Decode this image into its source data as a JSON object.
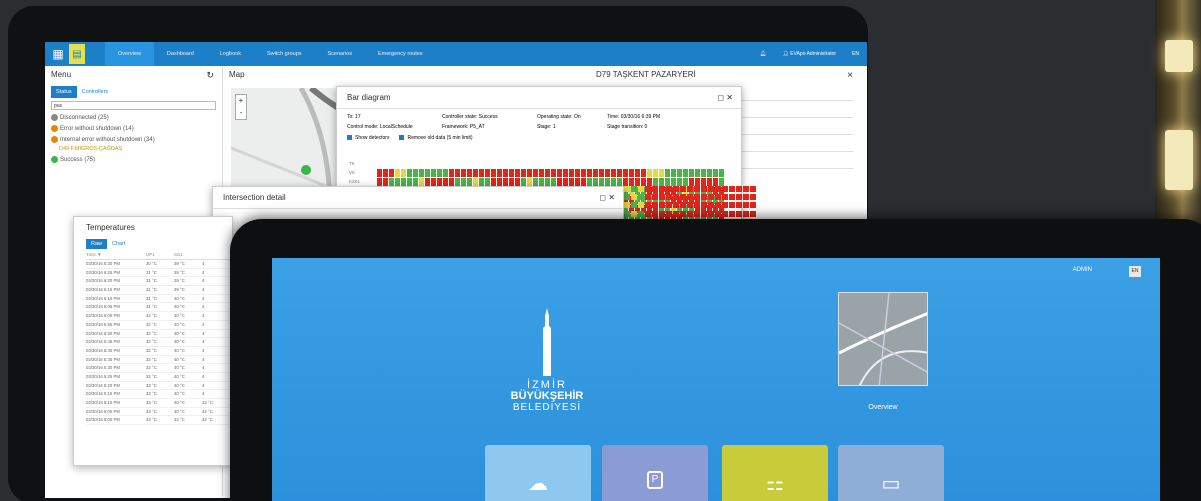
{
  "back_app": {
    "nav": {
      "tabs": [
        "Overview",
        "Dashboard",
        "Logbook",
        "Switch groups",
        "Scenarios",
        "Emergency routes"
      ],
      "active_tab": 0,
      "user": "EVApo Administrator",
      "lang": "EN"
    },
    "menu": {
      "title": "Menu",
      "tabs": [
        "Status",
        "Controllers"
      ],
      "search_value": "pus",
      "items": [
        {
          "label": "Disconnected (25)",
          "color": "#888888"
        },
        {
          "label": "Error without shutdown (14)",
          "color": "#e8830c"
        },
        {
          "label": "Internal error without shutdown (34)",
          "color": "#e8830c"
        },
        {
          "label": "Success (75)",
          "color": "#3ab54a"
        }
      ],
      "sub_item": "D49 F.MIGROS-ÇAĞDAŞ"
    },
    "map": {
      "title": "Map",
      "zoom_in": "+",
      "zoom_out": "-"
    },
    "right_panel": {
      "title": "D79 TAŞKENT PAZARYERİ",
      "close": "×"
    },
    "bar_diagram": {
      "title": "Bar diagram",
      "fields": [
        "To: 17",
        "Controller state: Success",
        "Operating state: On",
        "Time: 03/30/16 6:39 PM",
        "Control mode: LocalSchedule",
        "Framework: P5_AT",
        "Stage: 1",
        "Stage transition: 0"
      ],
      "checkboxes": [
        "Show detectors",
        "Remove old data (5 min limit)"
      ],
      "rows": [
        "TK",
        "VK",
        "K2K1",
        "",
        "",
        "",
        ""
      ]
    },
    "intersection": {
      "title": "Intersection detail"
    },
    "temperatures": {
      "title": "Temperatures",
      "tabs": [
        "Raw",
        "Chart"
      ],
      "headers": [
        "Time ▼",
        "UP1",
        "SS1",
        ""
      ],
      "rows": [
        [
          "03/30/16 6:30 PM",
          "30 °C",
          "39 °C",
          "4"
        ],
        [
          "03/30/16 6:25 PM",
          "31 °C",
          "39 °C",
          "4"
        ],
        [
          "03/30/16 6:20 PM",
          "31 °C",
          "39 °C",
          "4"
        ],
        [
          "03/30/16 6:15 PM",
          "31 °C",
          "39 °C",
          "4"
        ],
        [
          "03/30/16 6:10 PM",
          "31 °C",
          "40 °C",
          "4"
        ],
        [
          "03/30/16 6:05 PM",
          "31 °C",
          "40 °C",
          "4"
        ],
        [
          "03/30/16 6:00 PM",
          "32 °C",
          "40 °C",
          "4"
        ],
        [
          "03/30/16 5:55 PM",
          "32 °C",
          "40 °C",
          "4"
        ],
        [
          "03/30/16 5:50 PM",
          "32 °C",
          "40 °C",
          "4"
        ],
        [
          "03/30/16 5:45 PM",
          "32 °C",
          "40 °C",
          "4"
        ],
        [
          "03/30/16 5:40 PM",
          "32 °C",
          "40 °C",
          "4"
        ],
        [
          "03/30/16 5:35 PM",
          "32 °C",
          "40 °C",
          "4"
        ],
        [
          "03/30/16 5:30 PM",
          "32 °C",
          "40 °C",
          "4"
        ],
        [
          "03/30/16 5:25 PM",
          "32 °C",
          "40 °C",
          "4"
        ],
        [
          "03/30/16 5:20 PM",
          "33 °C",
          "40 °C",
          "4"
        ],
        [
          "03/30/16 5:15 PM",
          "33 °C",
          "40 °C",
          "4"
        ],
        [
          "03/30/16 5:10 PM",
          "33 °C",
          "40 °C",
          "42 °C"
        ],
        [
          "03/30/16 5:05 PM",
          "33 °C",
          "40 °C",
          "42 °C"
        ],
        [
          "03/30/16 5:00 PM",
          "33 °C",
          "42 °C",
          "42 °C"
        ]
      ]
    }
  },
  "front_app": {
    "admin_label": "ADMIN",
    "lang": "EN",
    "logo": {
      "line1": "İZMİR",
      "line2": "BÜYÜKŞEHİR",
      "line3": "BELEDİYESİ"
    },
    "overview_label": "Overview",
    "tiles": [
      {
        "icon": "cloud-icon",
        "color": "#8ec8ee"
      },
      {
        "icon": "parking-icon",
        "color": "#8b9bd4"
      },
      {
        "icon": "traffic-light-icon",
        "color": "#c9cc3a"
      },
      {
        "icon": "id-card-icon",
        "color": "#8faed6"
      }
    ]
  }
}
